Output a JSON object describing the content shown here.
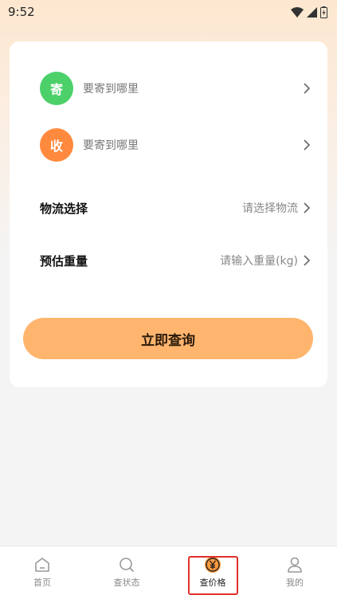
{
  "status_bar": {
    "time": "9:52"
  },
  "sender": {
    "badge": "寄",
    "placeholder": "要寄到哪里",
    "badge_color": "#4cd06a"
  },
  "receiver": {
    "badge": "收",
    "placeholder": "要寄到哪里",
    "badge_color": "#ff8a3d"
  },
  "logistics": {
    "label": "物流选择",
    "value": "请选择物流"
  },
  "weight": {
    "label": "预估重量",
    "value": "请输入重量(kg)"
  },
  "query_button": {
    "label": "立即查询",
    "color": "#ffb56e"
  },
  "tabbar": {
    "items": [
      {
        "label": "首页",
        "icon": "home-icon"
      },
      {
        "label": "查状态",
        "icon": "search-icon"
      },
      {
        "label": "查价格",
        "icon": "yuan-icon",
        "active": true
      },
      {
        "label": "我的",
        "icon": "user-icon"
      }
    ]
  },
  "accent_color": "#ff9a3d",
  "highlight_color": "#e0302a"
}
